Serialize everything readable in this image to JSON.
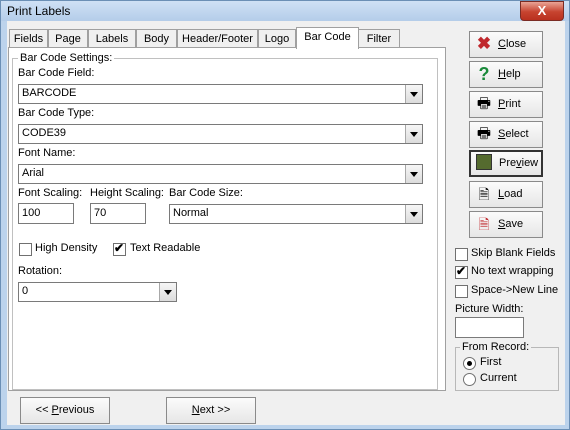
{
  "window": {
    "title": "Print Labels",
    "close_glyph": "X"
  },
  "tabs": [
    "Fields",
    "Page",
    "Labels",
    "Body",
    "Header/Footer",
    "Logo",
    "Bar Code",
    "Filter"
  ],
  "active_tab": "Bar Code",
  "group": {
    "label": "Bar Code Settings:"
  },
  "barcode_field": {
    "label": "Bar Code Field:",
    "value": "BARCODE"
  },
  "barcode_type": {
    "label": "Bar Code Type:",
    "value": "CODE39"
  },
  "font_name": {
    "label": "Font Name:",
    "value": "Arial"
  },
  "font_scaling": {
    "label": "Font Scaling:",
    "value": "100"
  },
  "height_scaling": {
    "label": "Height Scaling:",
    "value": "70"
  },
  "barcode_size": {
    "label": "Bar Code Size:",
    "value": "Normal"
  },
  "high_density": {
    "label": "High Density",
    "checked": false
  },
  "text_readable": {
    "label": "Text Readable",
    "checked": true,
    "mark": "✔"
  },
  "rotation": {
    "label": "Rotation:",
    "value": "0"
  },
  "side_buttons": {
    "close": {
      "key": "C",
      "rest": "lose",
      "icon": "close-icon"
    },
    "help": {
      "key": "H",
      "rest": "elp",
      "icon": "help-icon"
    },
    "print": {
      "key": "P",
      "rest": "rint",
      "icon": "print-icon"
    },
    "select": {
      "key": "S",
      "rest": "elect",
      "icon": "select-icon"
    },
    "preview": {
      "lead": "Pre",
      "key": "v",
      "rest": "iew",
      "icon": "preview-icon"
    },
    "load": {
      "key": "L",
      "rest": "oad",
      "icon": "load-icon"
    },
    "save": {
      "key": "S",
      "rest": "ave",
      "icon": "save-icon"
    }
  },
  "options": {
    "skip_blank": {
      "label": "Skip Blank Fields",
      "checked": false
    },
    "no_wrap": {
      "label": "No text wrapping",
      "checked": true,
      "mark": "✔"
    },
    "space_newline": {
      "label": "Space->New Line",
      "checked": false
    }
  },
  "picture_width": {
    "label": "Picture Width:",
    "value": ""
  },
  "from_record": {
    "label": "From Record:",
    "first": "First",
    "current": "Current",
    "selected": "First"
  },
  "nav": {
    "previous": {
      "lead": "<< ",
      "key": "P",
      "rest": "revious"
    },
    "next": {
      "key": "N",
      "rest": "ext >>"
    }
  },
  "colors": {
    "titlebar": "#bcd3ec",
    "close": "#c7432f",
    "accent_red": "#c0282d"
  }
}
